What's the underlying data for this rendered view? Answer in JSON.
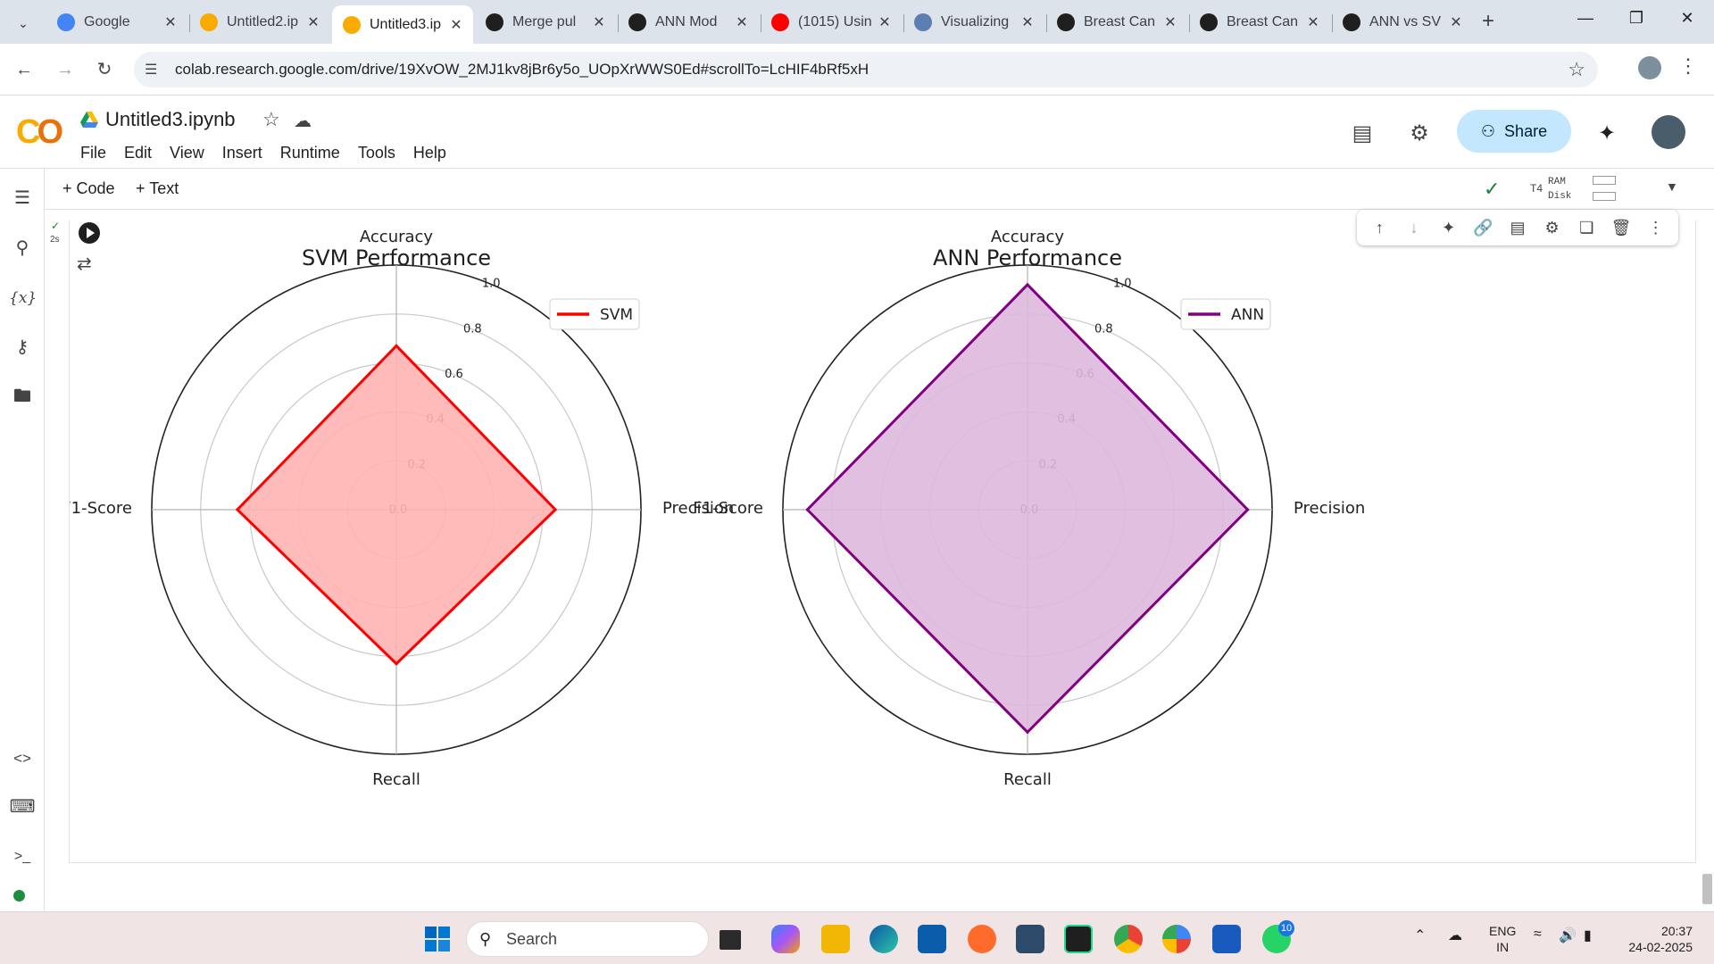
{
  "browser": {
    "tabs": [
      {
        "title": "Google",
        "favicon": "google-icon",
        "color": "#4285f4"
      },
      {
        "title": "Untitled2.ip",
        "favicon": "colab-icon",
        "color": "#f9ab00"
      },
      {
        "title": "Untitled3.ip",
        "favicon": "colab-icon",
        "color": "#f9ab00",
        "active": true
      },
      {
        "title": "Merge pul",
        "favicon": "github-icon",
        "color": "#1f1f1f"
      },
      {
        "title": "ANN Mod",
        "favicon": "chatgpt-icon",
        "color": "#1f1f1f"
      },
      {
        "title": "(1015) Usin",
        "favicon": "youtube-icon",
        "color": "#ff0000"
      },
      {
        "title": "Visualizing",
        "favicon": "web-icon",
        "color": "#5b7fb0"
      },
      {
        "title": "Breast Can",
        "favicon": "chatgpt-icon",
        "color": "#1f1f1f"
      },
      {
        "title": "Breast Can",
        "favicon": "chatgpt-icon",
        "color": "#1f1f1f"
      },
      {
        "title": "ANN vs SV",
        "favicon": "chatgpt-icon",
        "color": "#1f1f1f"
      }
    ],
    "url": "colab.research.google.com/drive/19XvOW_2MJ1kv8jBr6y5o_UOpXrWWS0Ed#scrollTo=LcHIF4bRf5xH"
  },
  "colab": {
    "notebook_title": "Untitled3.ipynb",
    "menu": [
      "File",
      "Edit",
      "View",
      "Insert",
      "Runtime",
      "Tools",
      "Help"
    ],
    "share_label": "Share",
    "toolbar": {
      "code_label": "Code",
      "text_label": "Text",
      "runtime_type": "T4",
      "ram_label": "RAM",
      "disk_label": "Disk"
    },
    "cell": {
      "exec_time": "2s"
    }
  },
  "chart_data": [
    {
      "type": "radar",
      "title": "SVM Performance",
      "categories": [
        "Accuracy",
        "Precision",
        "Recall",
        "F1-Score"
      ],
      "series": [
        {
          "name": "SVM",
          "values": [
            0.67,
            0.65,
            0.63,
            0.65
          ],
          "color": "#ff0000",
          "fill": "#ffb3b3"
        }
      ],
      "rlim": [
        0,
        1.0
      ],
      "rticks": [
        "0.0",
        "0.2",
        "0.4",
        "0.6",
        "0.8",
        "1.0"
      ],
      "legend": "top-right",
      "grid": true
    },
    {
      "type": "radar",
      "title": "ANN Performance",
      "categories": [
        "Accuracy",
        "Precision",
        "Recall",
        "F1-Score"
      ],
      "series": [
        {
          "name": "ANN",
          "values": [
            0.92,
            0.9,
            0.91,
            0.9
          ],
          "color": "#800080",
          "fill": "#ddb8dd"
        }
      ],
      "rlim": [
        0,
        1.0
      ],
      "rticks": [
        "0.0",
        "0.2",
        "0.4",
        "0.6",
        "0.8",
        "1.0"
      ],
      "legend": "top-right",
      "grid": true
    }
  ],
  "taskbar": {
    "search_placeholder": "Search",
    "whatsapp_badge": "10",
    "lang_top": "ENG",
    "lang_bottom": "IN",
    "time": "20:37",
    "date": "24-02-2025"
  }
}
